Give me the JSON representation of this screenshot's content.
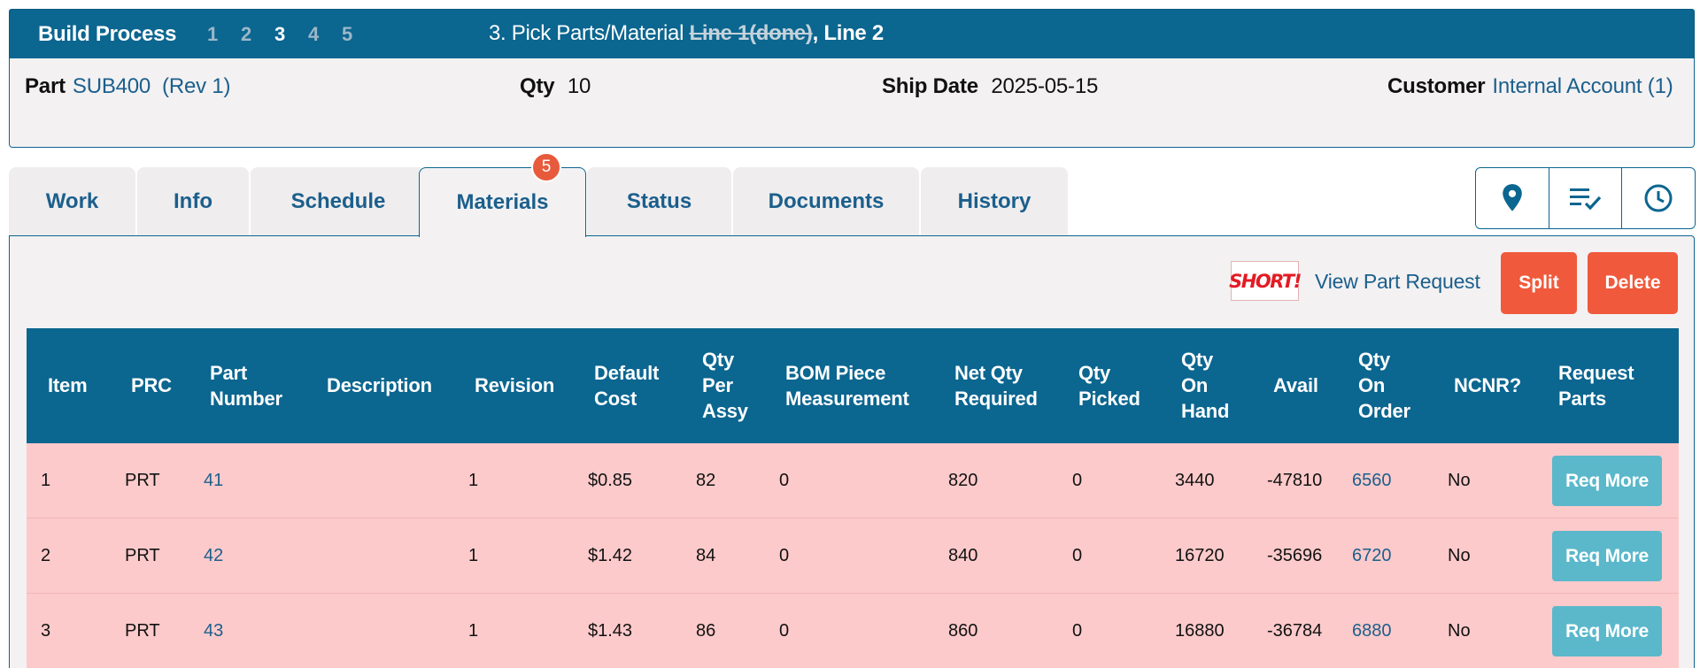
{
  "header": {
    "title": "Build Process",
    "steps": [
      "1",
      "2",
      "3",
      "4",
      "5"
    ],
    "active_step": "3",
    "step_prefix": "3. Pick Parts/Material ",
    "done_line": "Line 1(done)",
    "separator": ", ",
    "current_line": "Line 2"
  },
  "info": {
    "part_label": "Part",
    "part_value": "SUB400",
    "part_rev": "(Rev 1)",
    "qty_label": "Qty",
    "qty_value": "10",
    "ship_label": "Ship Date",
    "ship_value": "2025-05-15",
    "customer_label": "Customer",
    "customer_value": "Internal Account (1)"
  },
  "tabs": [
    {
      "label": "Work"
    },
    {
      "label": "Info"
    },
    {
      "label": "Schedule"
    },
    {
      "label": "Materials"
    },
    {
      "label": "Status"
    },
    {
      "label": "Documents"
    },
    {
      "label": "History"
    }
  ],
  "active_tab": "Materials",
  "materials_badge": "5",
  "icon_buttons": [
    "location-icon",
    "checklist-icon",
    "clock-icon"
  ],
  "actions": {
    "short_badge": "SHORT!",
    "view_request": "View Part Request",
    "split": "Split",
    "delete": "Delete"
  },
  "table": {
    "headers": [
      [
        "Item"
      ],
      [
        "PRC"
      ],
      [
        "Part",
        "Number"
      ],
      [
        "Description"
      ],
      [
        "Revision"
      ],
      [
        "Default",
        "Cost"
      ],
      [
        "Qty",
        "Per",
        "Assy"
      ],
      [
        "BOM Piece",
        "Measurement"
      ],
      [
        "Net Qty",
        "Required"
      ],
      [
        "Qty",
        "Picked"
      ],
      [
        "Qty",
        "On",
        "Hand"
      ],
      [
        "Avail"
      ],
      [
        "Qty",
        "On",
        "Order"
      ],
      [
        "NCNR?"
      ],
      [
        "Request",
        "Parts"
      ]
    ],
    "rows": [
      {
        "item": "1",
        "prc": "PRT",
        "part_number": "41",
        "description": "",
        "revision": "1",
        "default_cost": "$0.85",
        "qty_per_assy": "82",
        "bom_piece": "0",
        "net_qty_required": "820",
        "qty_picked": "0",
        "qty_on_hand": "3440",
        "avail": "-47810",
        "qty_on_order": "6560",
        "ncnr": "No",
        "request": "Req More"
      },
      {
        "item": "2",
        "prc": "PRT",
        "part_number": "42",
        "description": "",
        "revision": "1",
        "default_cost": "$1.42",
        "qty_per_assy": "84",
        "bom_piece": "0",
        "net_qty_required": "840",
        "qty_picked": "0",
        "qty_on_hand": "16720",
        "avail": "-35696",
        "qty_on_order": "6720",
        "ncnr": "No",
        "request": "Req More"
      },
      {
        "item": "3",
        "prc": "PRT",
        "part_number": "43",
        "description": "",
        "revision": "1",
        "default_cost": "$1.43",
        "qty_per_assy": "86",
        "bom_piece": "0",
        "net_qty_required": "860",
        "qty_picked": "0",
        "qty_on_hand": "16880",
        "avail": "-36784",
        "qty_on_order": "6880",
        "ncnr": "No",
        "request": "Req More"
      }
    ]
  },
  "colors": {
    "brand": "#0b6690",
    "link": "#1b5f8c",
    "danger": "#f0593b",
    "row_short": "#fdcacb",
    "req_button": "#5bb8cb",
    "badge": "#e85a3c"
  }
}
